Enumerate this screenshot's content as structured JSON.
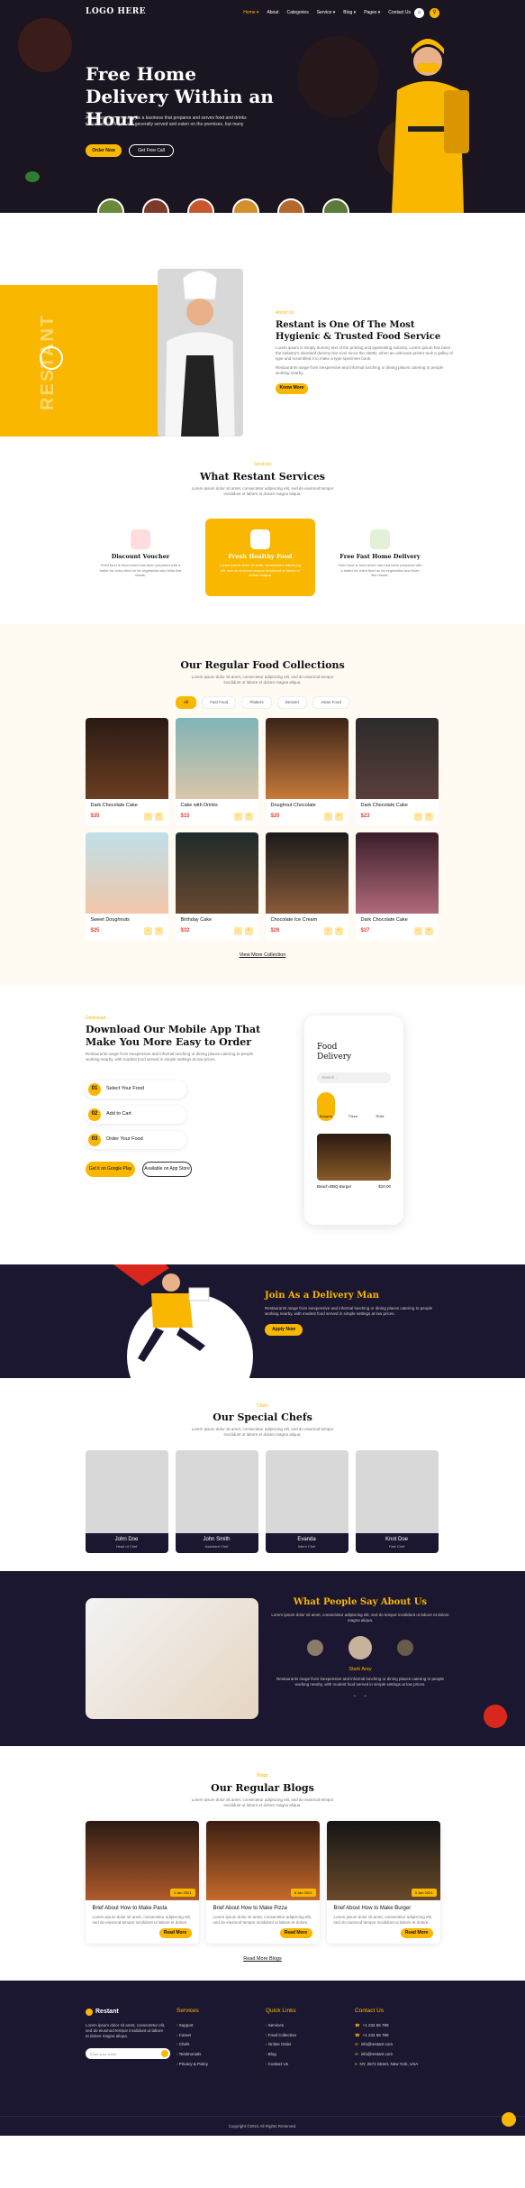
{
  "nav": {
    "logo": "LOGO HERE",
    "links": [
      "Home ▾",
      "About",
      "Categories",
      "Service ▾",
      "Blog ▾",
      "Pages ▾",
      "Contact Us"
    ]
  },
  "hero": {
    "title": "Free Home Delivery Within an Hour",
    "subtitle": "A restaurant or an eatery, is a business that prepares and serves food and drinks to customers. Meals are generally served and eaten on the premises, but many",
    "order_btn": "Order Now",
    "call_btn": "Get Free Call"
  },
  "about": {
    "vertical": "RESTANT",
    "tag": "About Us",
    "title": "Restant is One Of The Most Hygienic & Trusted Food Service",
    "p1": "Lorem ipsum is simply dummy text of the printing and typesetting industry. Lorem ipsum has been the industry's standard dummy text ever since the 1500s, when an unknown printer took a galley of type and scrambled it to make a type specimen book.",
    "p2": "Restaurants range from inexpensive and informal lunching or dining places catering to people working nearby.",
    "btn": "Know More"
  },
  "services": {
    "tag": "Services",
    "title": "What Restant Services",
    "desc": "Lorem ipsum dolor sit amet, consectetur adipiscing elit, sed do eiusmod tempor incididunt ut labore et dolore magna aliqua.",
    "items": [
      {
        "title": "Discount Voucher",
        "desc": "Fried food is food which has been prepared with a batter for extra fried on its vegetables and fruits like meats."
      },
      {
        "title": "Fresh Healthy Food",
        "desc": "Lorem ipsum dolor sit amet, consectetur adipiscing elit, sed do eiusmod tempor incididunt ut labore et dolore magna."
      },
      {
        "title": "Free Fast Home Delivery",
        "desc": "Fried food is food which has had been prepared with a batter for extra fried on its vegetables and fruits like meats."
      }
    ]
  },
  "food": {
    "title": "Our Regular Food Collections",
    "desc": "Lorem ipsum dolor sit amet, consectetur adipiscing elit, sed do eiusmod tempor incididunt ut labore et dolore magna aliqua.",
    "tabs": [
      "All",
      "Fast Food",
      "Platters",
      "Dessert",
      "Asian Food"
    ],
    "items": [
      {
        "name": "Dark Chocolate Cake",
        "price": "$35"
      },
      {
        "name": "Cake with Drinks",
        "price": "$15"
      },
      {
        "name": "Doughnut Chocolate",
        "price": "$20"
      },
      {
        "name": "Dark Chocolate Cake",
        "price": "$23"
      },
      {
        "name": "Sweet Doughnuts",
        "price": "$25"
      },
      {
        "name": "Birthday Cake",
        "price": "$32"
      },
      {
        "name": "Chocolate Ice Cream",
        "price": "$26"
      },
      {
        "name": "Dark Chocolate Cake",
        "price": "$27"
      }
    ],
    "more": "View More Collection"
  },
  "app": {
    "tag": "Download",
    "title": "Download Our Mobile App That Make You More Easy to Order",
    "desc": "Restaurants range from inexpensive and informal lunching or dining places catering to people working nearby, with modest food served in simple settings at low prices.",
    "steps": [
      {
        "n": "01",
        "t": "Select Your Food"
      },
      {
        "n": "02",
        "t": "Add to Cart"
      },
      {
        "n": "03",
        "t": "Order Your Food"
      }
    ],
    "gplay": "Get it on Google Play",
    "astore": "Available on App Store",
    "phone": {
      "t1": "Food",
      "t2": "Delivery",
      "search": "Search...",
      "cats": [
        "Burgers",
        "Pizza",
        "Rolls"
      ],
      "item": "Beach BBQ Burger",
      "price": "$10.00"
    }
  },
  "delivery": {
    "title": "Join As a Delivery Man",
    "desc": "Restaurants range from inexpensive and informal lunching or dining places catering to people working nearby, with modest food served in simple settings at low prices.",
    "btn": "Apply Now"
  },
  "chefs": {
    "tag": "Chefs",
    "title": "Our Special Chefs",
    "desc": "Lorem ipsum dolor sit amet, consectetur adipiscing elit, sed do eiusmod tempor incididunt ut labore et dolore magna aliqua.",
    "items": [
      {
        "name": "John Doe",
        "role": "Head of Chef"
      },
      {
        "name": "John Smith",
        "role": "Assistant Chef"
      },
      {
        "name": "Evanda",
        "role": "Intern Chef"
      },
      {
        "name": "Knot Doe",
        "role": "Fast Chef"
      }
    ]
  },
  "testi": {
    "title": "What People Say About Us",
    "desc": "Lorem ipsum dolor sit amet, consectetur adipiscing elit, sed do tempor incididunt ut labore et dolore magna aliqua.",
    "name": "Stark Arey",
    "quote": "Restaurants range from inexpensive and informal lunching or dining places catering to people working nearby, with modest food served in simple settings at low prices."
  },
  "blogs": {
    "tag": "Blogs",
    "title": "Our Regular Blogs",
    "desc": "Lorem ipsum dolor sit amet, consectetur adipiscing elit, sed do eiusmod tempor incididunt ut labore et dolore magna aliqua.",
    "items": [
      {
        "title": "Brief About How to Make Pasta",
        "date": "4 Jan 2021"
      },
      {
        "title": "Brief About How to Make Pizza",
        "date": "8 Jan 2021"
      },
      {
        "title": "Brief About How to Make Burger",
        "date": "9 Jan 2021"
      }
    ],
    "excerpt": "Lorem ipsum dolor sit amet, consectetur adipiscing elit, sed do eiusmod tempor incididunt ut labore et dolore.",
    "read": "Read More",
    "more": "Read More Blogs"
  },
  "footer": {
    "logo": "Restant",
    "desc": "Lorem ipsum dolor sit amet, consectetur elit, sed do eiusmod tempor incididunt ut labore et dolore magna aliqua.",
    "email_ph": "Enter your email",
    "services_title": "Services",
    "services": [
      "Support",
      "Career",
      "Chefs",
      "Testimonials",
      "Privacy & Policy"
    ],
    "quick_title": "Quick Links",
    "quick": [
      "Services",
      "Food Collection",
      "Online Order",
      "Blog",
      "Contact Us"
    ],
    "contact_title": "Contact Us",
    "contact": [
      "+1 234 56 789",
      "+1 234 56 789",
      "info@restant.com",
      "info@restant.com",
      "NY, 2673 Street, New York, USA"
    ],
    "copyright": "Copyright ©2021 All Rights Reserved."
  }
}
